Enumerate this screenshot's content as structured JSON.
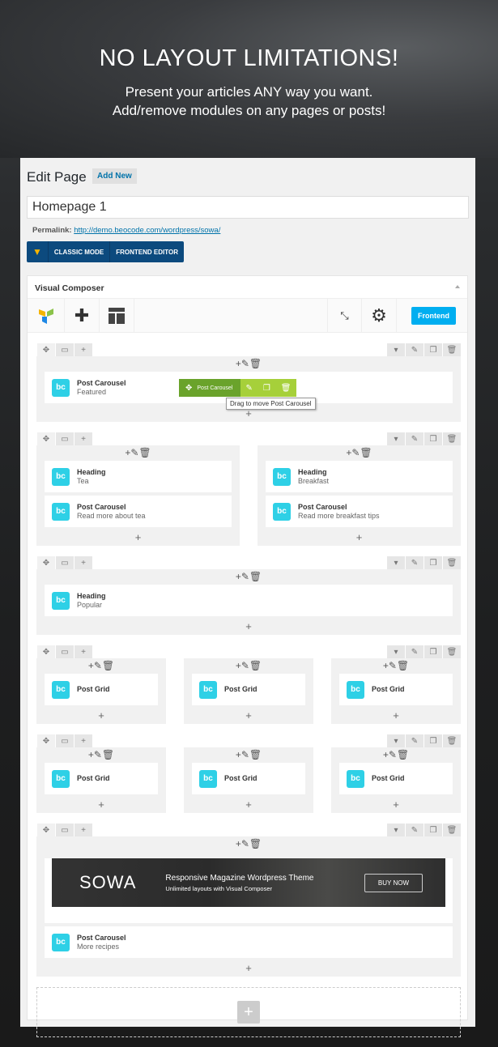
{
  "hero": {
    "title": "NO LAYOUT LIMITATIONS!",
    "line1": "Present your articles ANY way you want.",
    "line2": "Add/remove modules on any pages or posts!"
  },
  "header": {
    "title": "Edit Page",
    "add_new": "Add New"
  },
  "post_title": "Homepage 1",
  "permalink": {
    "label": "Permalink:",
    "url": "http://demo.beocode.com/wordpress/sowa/"
  },
  "modes": {
    "classic": "CLASSIC MODE",
    "frontend_editor": "FRONTEND EDITOR"
  },
  "vc": {
    "title": "Visual Composer",
    "frontend_button": "Frontend"
  },
  "element_icon_text": "bc",
  "drag_bar": {
    "label": "Post Carousel",
    "tooltip": "Drag to move Post Carousel"
  },
  "rows": [
    {
      "columns": [
        [
          {
            "title": "Post Carousel",
            "subtitle": "Featured",
            "hover": true
          }
        ]
      ]
    },
    {
      "columns": [
        [
          {
            "title": "Heading",
            "subtitle": "Tea"
          },
          {
            "title": "Post Carousel",
            "subtitle": "Read more about tea"
          }
        ],
        [
          {
            "title": "Heading",
            "subtitle": "Breakfast"
          },
          {
            "title": "Post Carousel",
            "subtitle": "Read more breakfast tips"
          }
        ]
      ]
    },
    {
      "columns": [
        [
          {
            "title": "Heading",
            "subtitle": "Popular"
          }
        ]
      ]
    },
    {
      "columns": [
        [
          {
            "title": "Post Grid",
            "subtitle": ""
          }
        ],
        [
          {
            "title": "Post Grid",
            "subtitle": ""
          }
        ],
        [
          {
            "title": "Post Grid",
            "subtitle": ""
          }
        ]
      ]
    },
    {
      "columns": [
        [
          {
            "title": "Post Grid",
            "subtitle": ""
          }
        ],
        [
          {
            "title": "Post Grid",
            "subtitle": ""
          }
        ],
        [
          {
            "title": "Post Grid",
            "subtitle": ""
          }
        ]
      ]
    },
    {
      "columns": [
        [
          {
            "banner": true
          },
          {
            "title": "Post Carousel",
            "subtitle": "More recipes"
          }
        ]
      ]
    }
  ],
  "banner": {
    "logo": "SOWA",
    "headline": "Responsive Magazine Wordpress Theme",
    "subline": "Unlimited layouts with Visual Composer",
    "button": "BUY NOW"
  },
  "colors": {
    "accent": "#00aef0",
    "element_icon": "#2ed0e6",
    "mode_bar": "#0c4a7e",
    "drag_green": "#6aa32b",
    "drag_light_green": "#a6d03a"
  }
}
